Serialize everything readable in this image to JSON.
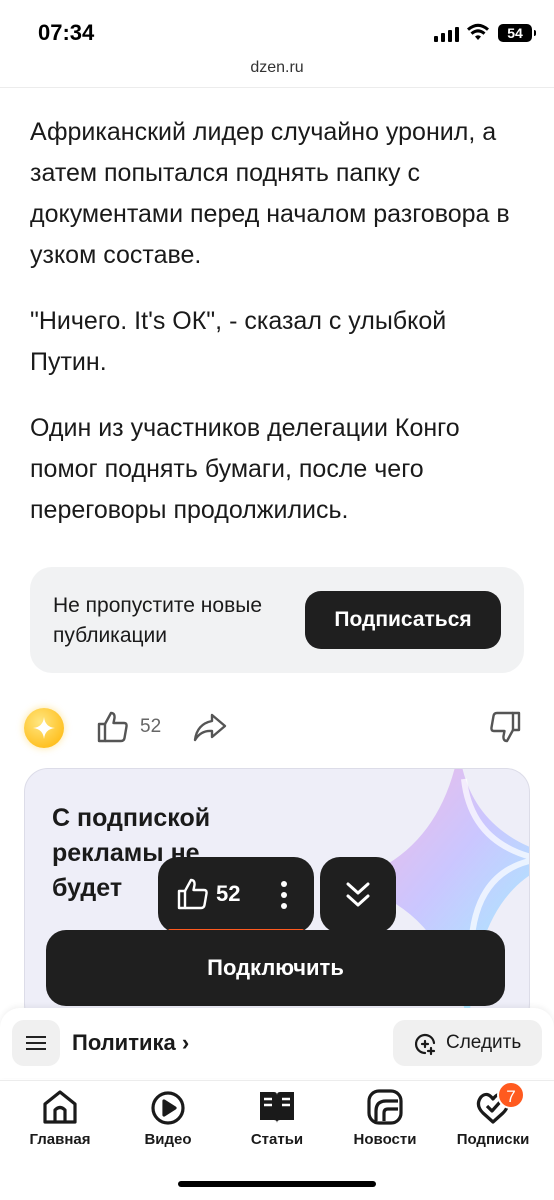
{
  "status_bar": {
    "time": "07:34",
    "battery": "54"
  },
  "browser": {
    "url": "dzen.ru"
  },
  "article": {
    "paragraphs": [
      "Африканский лидер случайно уронил, а затем попытался поднять папку с документами перед началом разговора в узком составе.",
      "\"Ничего. It's ОК\", - сказал с улыбкой Путин.",
      "Один из участников делегации Конго помог поднять бумаги, после чего переговоры продолжились."
    ]
  },
  "subscribe_card": {
    "text": "Не пропустите новые публикации",
    "button_label": "Подписаться"
  },
  "actions": {
    "like_count": "52"
  },
  "promo": {
    "title": "С подпиской рекламы не будет",
    "connect_label": "Подключить"
  },
  "floating": {
    "like_count": "52"
  },
  "topic_bar": {
    "topic": "Политика ›",
    "follow_label": "Следить"
  },
  "tabbar": {
    "tabs": [
      {
        "label": "Главная",
        "icon": "home-icon"
      },
      {
        "label": "Видео",
        "icon": "video-play-icon"
      },
      {
        "label": "Статьи",
        "icon": "articles-book-icon"
      },
      {
        "label": "Новости",
        "icon": "news-globe-icon"
      },
      {
        "label": "Подписки",
        "icon": "subscriptions-icon",
        "badge": "7"
      }
    ]
  },
  "colors": {
    "accent": "#ff5a1f",
    "dark": "#1f1f1f",
    "card_bg": "#f1f2f3"
  }
}
